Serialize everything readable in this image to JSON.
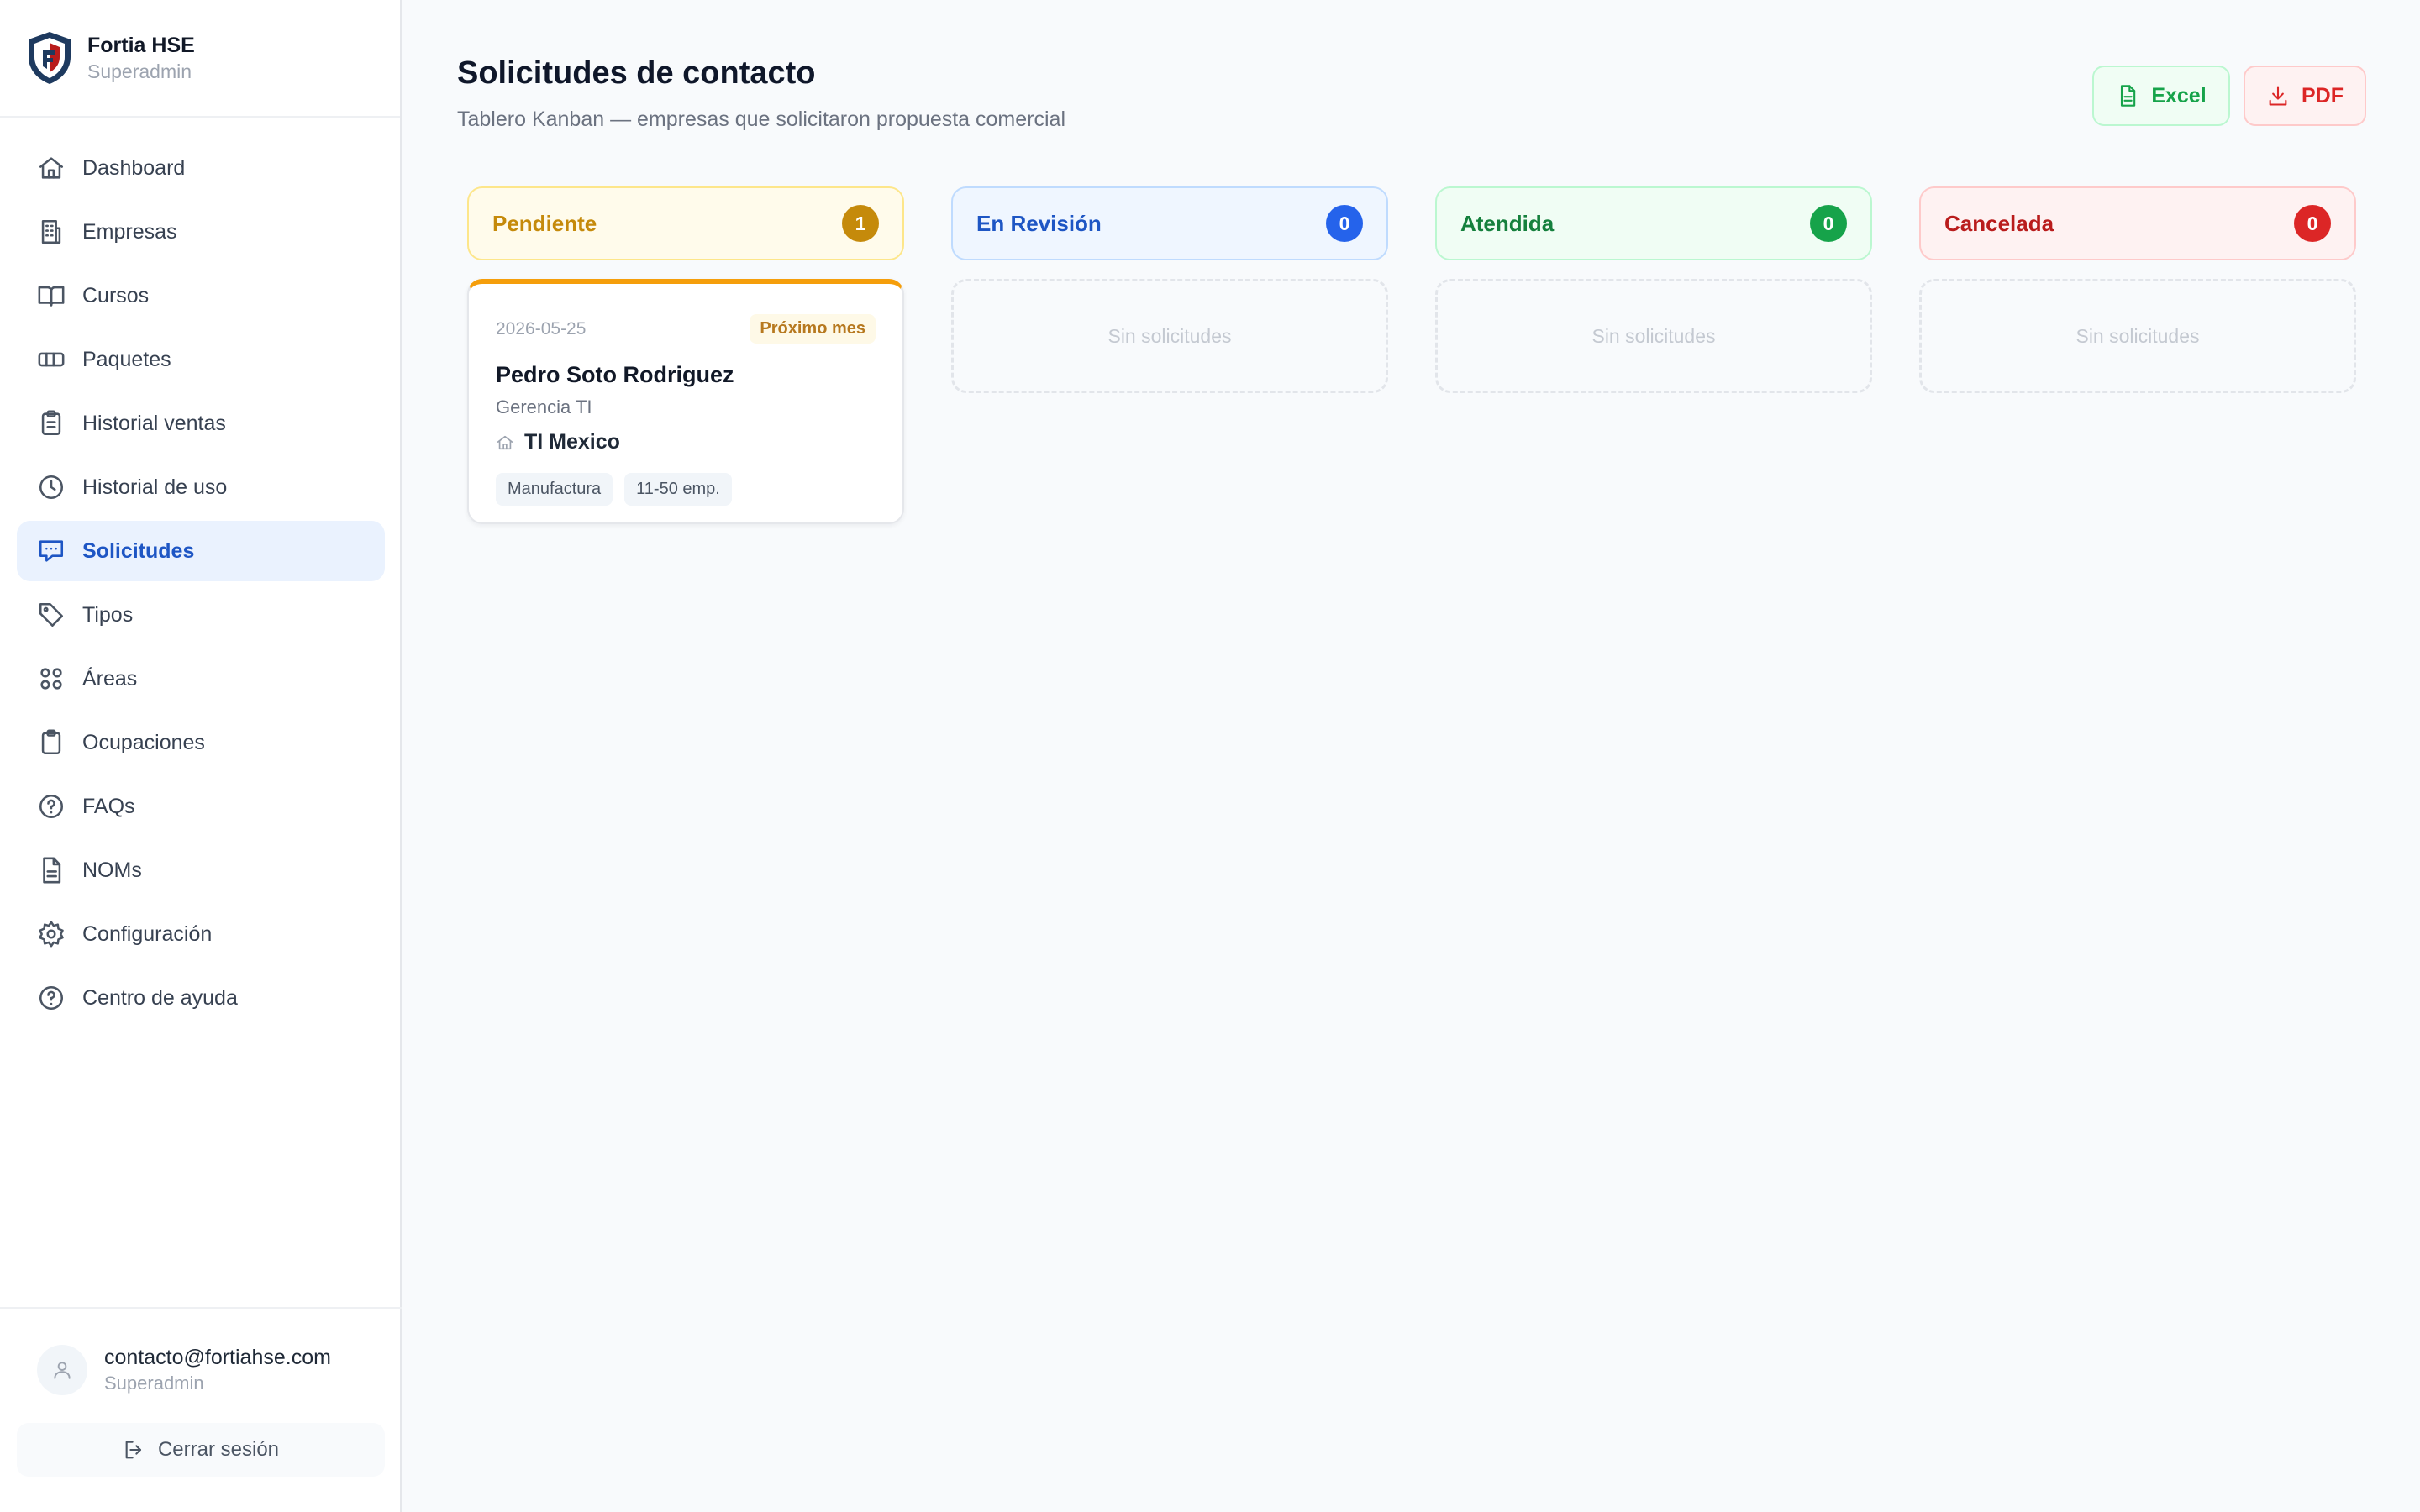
{
  "brand": {
    "name": "Fortia HSE",
    "role": "Superadmin"
  },
  "sidebar": {
    "items": [
      {
        "label": "Dashboard",
        "icon": "home-icon"
      },
      {
        "label": "Empresas",
        "icon": "building-icon"
      },
      {
        "label": "Cursos",
        "icon": "book-icon"
      },
      {
        "label": "Paquetes",
        "icon": "package-icon"
      },
      {
        "label": "Historial ventas",
        "icon": "clipboard-list-icon"
      },
      {
        "label": "Historial de uso",
        "icon": "clock-icon"
      },
      {
        "label": "Solicitudes",
        "icon": "message-icon",
        "active": true
      },
      {
        "label": "Tipos",
        "icon": "tag-icon"
      },
      {
        "label": "Áreas",
        "icon": "grid-icon"
      },
      {
        "label": "Ocupaciones",
        "icon": "clipboard-icon"
      },
      {
        "label": "FAQs",
        "icon": "help-circle-icon"
      },
      {
        "label": "NOMs",
        "icon": "file-text-icon"
      },
      {
        "label": "Configuración",
        "icon": "gear-icon"
      },
      {
        "label": "Centro de ayuda",
        "icon": "help-circle-icon"
      }
    ]
  },
  "user": {
    "email": "contacto@fortiahse.com",
    "role": "Superadmin",
    "logout_label": "Cerrar sesión"
  },
  "header": {
    "title": "Solicitudes de contacto",
    "subtitle": "Tablero Kanban — empresas que solicitaron propuesta comercial",
    "excel_label": "Excel",
    "pdf_label": "PDF"
  },
  "colors": {
    "pending": "#f59e0b",
    "review": "#2563eb",
    "done": "#16a34a",
    "cancel": "#dc2626"
  },
  "columns": [
    {
      "title": "Pendiente",
      "count": "1",
      "empty_text": ""
    },
    {
      "title": "En Revisión",
      "count": "0",
      "empty_text": "Sin solicitudes"
    },
    {
      "title": "Atendida",
      "count": "0",
      "empty_text": "Sin solicitudes"
    },
    {
      "title": "Cancelada",
      "count": "0",
      "empty_text": "Sin solicitudes"
    }
  ],
  "card": {
    "date": "2026-05-25",
    "badge": "Próximo mes",
    "name": "Pedro Soto Rodriguez",
    "role": "Gerencia TI",
    "company": "TI Mexico",
    "tags": [
      "Manufactura",
      "11-50 emp."
    ]
  }
}
